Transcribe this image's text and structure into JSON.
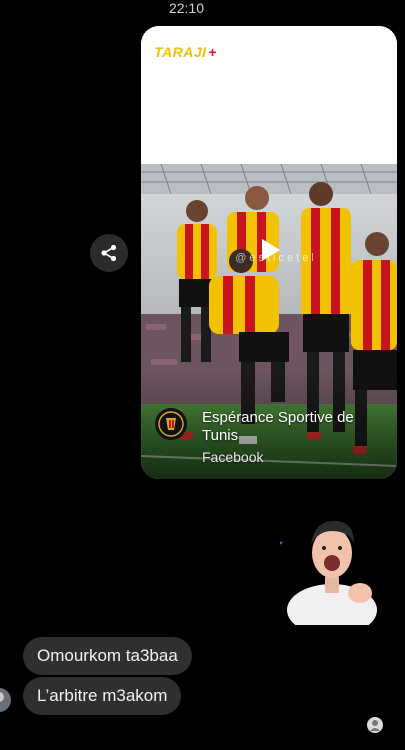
{
  "status_bar": {
    "time": "22:10"
  },
  "shared_post": {
    "brand_text": "TARAJI",
    "brand_plus": "+",
    "watermark": "@esticetel",
    "page_name": "Espérance Sportive de Tunis",
    "platform": "Facebook"
  },
  "messages": [
    {
      "text": "Omourkom ta3baa"
    },
    {
      "text": "L’arbitre m3akom"
    }
  ],
  "colors": {
    "background": "#000000",
    "bubble": "#2f2f2f",
    "brand_yellow": "#f2c200",
    "brand_red": "#e2142b"
  },
  "icons": {
    "share": "share-icon",
    "play": "play-icon"
  }
}
